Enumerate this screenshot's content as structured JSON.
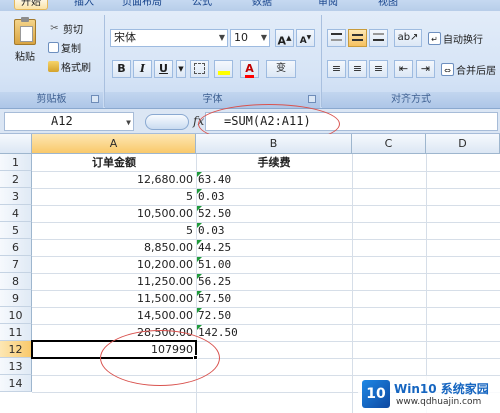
{
  "tabs": [
    "开始",
    "插入",
    "页面布局",
    "公式",
    "数据",
    "审阅",
    "视图"
  ],
  "clipboard": {
    "paste": "粘贴",
    "cut": "剪切",
    "copy": "复制",
    "format_painter": "格式刷",
    "group": "剪贴板"
  },
  "font": {
    "name": "宋体",
    "size": "10",
    "bold": "B",
    "italic": "I",
    "underline": "U",
    "group": "字体",
    "pinyin": "变"
  },
  "alignment": {
    "wrap": "自动换行",
    "merge": "合并后居",
    "group": "对齐方式"
  },
  "namebox": "A12",
  "fx_label": "fx",
  "formula": "=SUM(A2:A11)",
  "columns": [
    "A",
    "B",
    "C",
    "D"
  ],
  "rows": [
    "1",
    "2",
    "3",
    "4",
    "5",
    "6",
    "7",
    "8",
    "9",
    "10",
    "11",
    "12",
    "13",
    "14"
  ],
  "headers": {
    "a1": "订单金额",
    "b1": "手续费"
  },
  "data_rows": [
    {
      "a": "12,680.00",
      "b": "63.40"
    },
    {
      "a": "5",
      "b": "0.03"
    },
    {
      "a": "10,500.00",
      "b": "52.50"
    },
    {
      "a": "5",
      "b": "0.03"
    },
    {
      "a": "8,850.00",
      "b": "44.25"
    },
    {
      "a": "10,200.00",
      "b": "51.00"
    },
    {
      "a": "11,250.00",
      "b": "56.25"
    },
    {
      "a": "11,500.00",
      "b": "57.50"
    },
    {
      "a": "14,500.00",
      "b": "72.50"
    },
    {
      "a": "28,500.00",
      "b": "142.50"
    }
  ],
  "total": "107990",
  "watermark": {
    "brand": "Win10 系统家园",
    "url": "www.qdhuajin.com",
    "logo_text": "10"
  },
  "colors": {
    "selection": "#000000",
    "annotation": "#d9534f",
    "error_triangle": "#1f9a3a"
  }
}
